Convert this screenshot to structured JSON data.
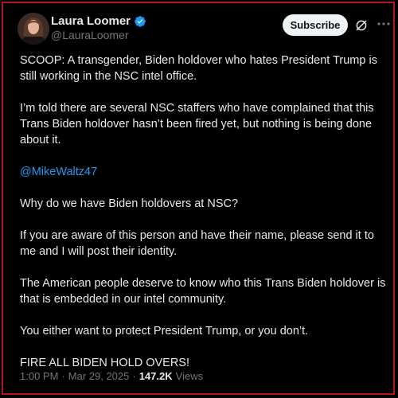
{
  "author": {
    "name": "Laura Loomer",
    "handle": "@LauraLoomer",
    "verified_icon": "verified-badge-icon",
    "verified_color": "#1d9bf0"
  },
  "actions": {
    "subscribe_label": "Subscribe",
    "grok_icon": "grok-icon",
    "more_icon": "more-icon"
  },
  "tweet": {
    "paragraphs": [
      "SCOOP: A transgender, Biden holdover who hates President Trump is still working in the NSC intel office.",
      "I’m told there are several NSC staffers who have complained that this Trans Biden holdover hasn’t been fired yet, but nothing is being done about it.",
      "@MikeWaltz47",
      "Why do we have Biden holdovers at NSC?",
      "If you are aware of this person and have their name, please send it to me and I will post their identity.",
      "The American people deserve to know who this Trans Biden holdover is that is embedded in our intel community.",
      "You either want to protect President Trump, or you don’t.",
      "FIRE ALL BIDEN HOLD OVERS!"
    ]
  },
  "meta": {
    "time": "1:00 PM",
    "separator": "·",
    "date": "Mar 29, 2025",
    "separator2": "·",
    "views_count": "147.2K",
    "views_label": "Views"
  },
  "colors": {
    "background": "#000000",
    "text": "#e7e9ea",
    "muted": "#71767b",
    "link": "#1d9bf0",
    "frame": "#b0161b"
  }
}
